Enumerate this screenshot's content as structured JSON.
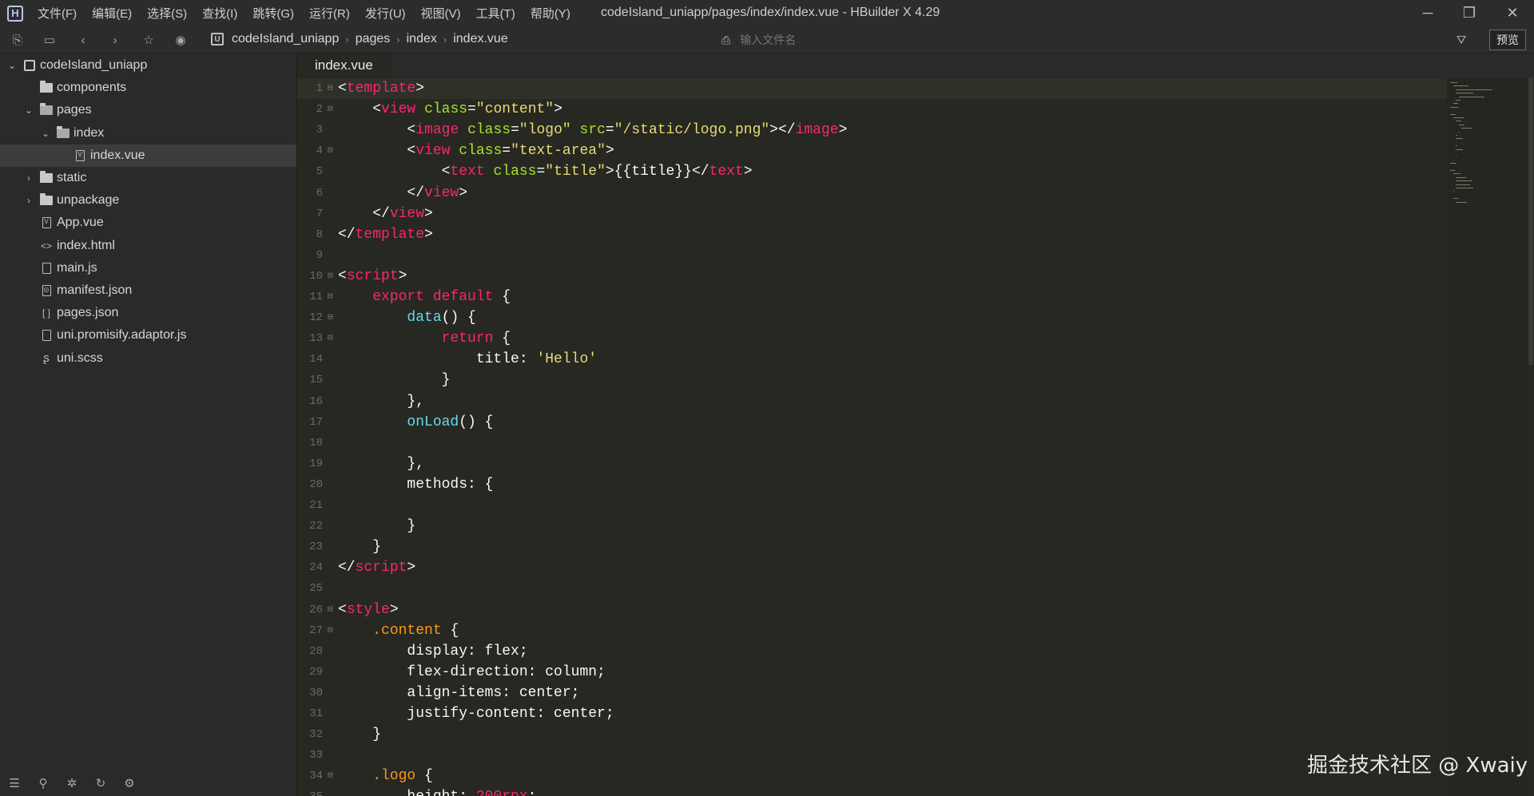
{
  "window": {
    "title": "codeIsland_uniapp/pages/index/index.vue - HBuilder X 4.29",
    "menus": [
      "文件(F)",
      "编辑(E)",
      "选择(S)",
      "查找(I)",
      "跳转(G)",
      "运行(R)",
      "发行(U)",
      "视图(V)",
      "工具(T)",
      "帮助(Y)"
    ]
  },
  "toolbar": {
    "breadcrumbs": [
      "codeIsland_uniapp",
      "pages",
      "index",
      "index.vue"
    ],
    "file_search_placeholder": "输入文件名",
    "preview_label": "预览"
  },
  "sidebar": {
    "items": [
      {
        "label": "codeIsland_uniapp",
        "type": "project",
        "depth": 0,
        "caret": "open"
      },
      {
        "label": "components",
        "type": "folder",
        "depth": 1,
        "caret": "none"
      },
      {
        "label": "pages",
        "type": "folder-open",
        "depth": 1,
        "caret": "open"
      },
      {
        "label": "index",
        "type": "folder-open",
        "depth": 2,
        "caret": "open"
      },
      {
        "label": "index.vue",
        "type": "vue",
        "depth": 3,
        "caret": "none",
        "selected": true
      },
      {
        "label": "static",
        "type": "folder",
        "depth": 1,
        "caret": "closed"
      },
      {
        "label": "unpackage",
        "type": "folder",
        "depth": 1,
        "caret": "closed"
      },
      {
        "label": "App.vue",
        "type": "vue",
        "depth": 1,
        "caret": "none"
      },
      {
        "label": "index.html",
        "type": "html",
        "depth": 1,
        "caret": "none"
      },
      {
        "label": "main.js",
        "type": "js",
        "depth": 1,
        "caret": "none"
      },
      {
        "label": "manifest.json",
        "type": "manifest",
        "depth": 1,
        "caret": "none"
      },
      {
        "label": "pages.json",
        "type": "json",
        "depth": 1,
        "caret": "none"
      },
      {
        "label": "uni.promisify.adaptor.js",
        "type": "js",
        "depth": 1,
        "caret": "none"
      },
      {
        "label": "uni.scss",
        "type": "scss",
        "depth": 1,
        "caret": "none"
      }
    ]
  },
  "editor": {
    "tab_label": "index.vue",
    "lines": [
      {
        "n": "1",
        "fold": true,
        "tokens": [
          [
            "t-tag",
            "<"
          ],
          [
            "t-key",
            "template"
          ],
          [
            "t-tag",
            ">"
          ]
        ]
      },
      {
        "n": "2",
        "fold": true,
        "tokens": [
          [
            "t-prop",
            "    "
          ],
          [
            "t-tag",
            "<"
          ],
          [
            "t-key",
            "view"
          ],
          [
            "t-prop",
            " "
          ],
          [
            "t-attr",
            "class"
          ],
          [
            "t-prop",
            "="
          ],
          [
            "t-str",
            "\"content\""
          ],
          [
            "t-tag",
            ">"
          ]
        ]
      },
      {
        "n": "3",
        "fold": false,
        "tokens": [
          [
            "t-prop",
            "        "
          ],
          [
            "t-tag",
            "<"
          ],
          [
            "t-key",
            "image"
          ],
          [
            "t-prop",
            " "
          ],
          [
            "t-attr",
            "class"
          ],
          [
            "t-prop",
            "="
          ],
          [
            "t-str",
            "\"logo\""
          ],
          [
            "t-prop",
            " "
          ],
          [
            "t-attr",
            "src"
          ],
          [
            "t-prop",
            "="
          ],
          [
            "t-str",
            "\"/static/logo.png\""
          ],
          [
            "t-tag",
            "></"
          ],
          [
            "t-key",
            "image"
          ],
          [
            "t-tag",
            ">"
          ]
        ]
      },
      {
        "n": "4",
        "fold": true,
        "tokens": [
          [
            "t-prop",
            "        "
          ],
          [
            "t-tag",
            "<"
          ],
          [
            "t-key",
            "view"
          ],
          [
            "t-prop",
            " "
          ],
          [
            "t-attr",
            "class"
          ],
          [
            "t-prop",
            "="
          ],
          [
            "t-str",
            "\"text-area\""
          ],
          [
            "t-tag",
            ">"
          ]
        ]
      },
      {
        "n": "5",
        "fold": false,
        "tokens": [
          [
            "t-prop",
            "            "
          ],
          [
            "t-tag",
            "<"
          ],
          [
            "t-key",
            "text"
          ],
          [
            "t-prop",
            " "
          ],
          [
            "t-attr",
            "class"
          ],
          [
            "t-prop",
            "="
          ],
          [
            "t-str",
            "\"title\""
          ],
          [
            "t-tag",
            ">"
          ],
          [
            "t-prop",
            "{{title}}"
          ],
          [
            "t-tag",
            "</"
          ],
          [
            "t-key",
            "text"
          ],
          [
            "t-tag",
            ">"
          ]
        ]
      },
      {
        "n": "6",
        "fold": false,
        "tokens": [
          [
            "t-prop",
            "        "
          ],
          [
            "t-tag",
            "</"
          ],
          [
            "t-key",
            "view"
          ],
          [
            "t-tag",
            ">"
          ]
        ]
      },
      {
        "n": "7",
        "fold": false,
        "tokens": [
          [
            "t-prop",
            "    "
          ],
          [
            "t-tag",
            "</"
          ],
          [
            "t-key",
            "view"
          ],
          [
            "t-tag",
            ">"
          ]
        ]
      },
      {
        "n": "8",
        "fold": false,
        "tokens": [
          [
            "t-tag",
            "</"
          ],
          [
            "t-key",
            "template"
          ],
          [
            "t-tag",
            ">"
          ]
        ]
      },
      {
        "n": "9",
        "fold": false,
        "tokens": []
      },
      {
        "n": "10",
        "fold": true,
        "tokens": [
          [
            "t-tag",
            "<"
          ],
          [
            "t-key",
            "script"
          ],
          [
            "t-tag",
            ">"
          ]
        ]
      },
      {
        "n": "11",
        "fold": true,
        "tokens": [
          [
            "t-prop",
            "    "
          ],
          [
            "t-key",
            "export"
          ],
          [
            "t-prop",
            " "
          ],
          [
            "t-key",
            "default"
          ],
          [
            "t-prop",
            " {"
          ]
        ]
      },
      {
        "n": "12",
        "fold": true,
        "tokens": [
          [
            "t-prop",
            "        "
          ],
          [
            "t-fn",
            "data"
          ],
          [
            "t-prop",
            "() {"
          ]
        ]
      },
      {
        "n": "13",
        "fold": true,
        "tokens": [
          [
            "t-prop",
            "            "
          ],
          [
            "t-key",
            "return"
          ],
          [
            "t-prop",
            " {"
          ]
        ]
      },
      {
        "n": "14",
        "fold": false,
        "tokens": [
          [
            "t-prop",
            "                title: "
          ],
          [
            "t-str",
            "'Hello'"
          ]
        ]
      },
      {
        "n": "15",
        "fold": false,
        "tokens": [
          [
            "t-prop",
            "            }"
          ]
        ]
      },
      {
        "n": "16",
        "fold": false,
        "tokens": [
          [
            "t-prop",
            "        },"
          ]
        ]
      },
      {
        "n": "17",
        "fold": false,
        "tokens": [
          [
            "t-prop",
            "        "
          ],
          [
            "t-fn",
            "onLoad"
          ],
          [
            "t-prop",
            "() {"
          ]
        ]
      },
      {
        "n": "18",
        "fold": false,
        "tokens": []
      },
      {
        "n": "19",
        "fold": false,
        "tokens": [
          [
            "t-prop",
            "        },"
          ]
        ]
      },
      {
        "n": "20",
        "fold": false,
        "tokens": [
          [
            "t-prop",
            "        methods: {"
          ]
        ]
      },
      {
        "n": "21",
        "fold": false,
        "tokens": []
      },
      {
        "n": "22",
        "fold": false,
        "tokens": [
          [
            "t-prop",
            "        }"
          ]
        ]
      },
      {
        "n": "23",
        "fold": false,
        "tokens": [
          [
            "t-prop",
            "    }"
          ]
        ]
      },
      {
        "n": "24",
        "fold": false,
        "tokens": [
          [
            "t-tag",
            "</"
          ],
          [
            "t-key",
            "script"
          ],
          [
            "t-tag",
            ">"
          ]
        ]
      },
      {
        "n": "25",
        "fold": false,
        "tokens": []
      },
      {
        "n": "26",
        "fold": true,
        "tokens": [
          [
            "t-tag",
            "<"
          ],
          [
            "t-key",
            "style"
          ],
          [
            "t-tag",
            ">"
          ]
        ]
      },
      {
        "n": "27",
        "fold": true,
        "tokens": [
          [
            "t-prop",
            "    "
          ],
          [
            "t-sel",
            ".content"
          ],
          [
            "t-prop",
            " {"
          ]
        ]
      },
      {
        "n": "28",
        "fold": false,
        "tokens": [
          [
            "t-prop",
            "        display: flex;"
          ]
        ]
      },
      {
        "n": "29",
        "fold": false,
        "tokens": [
          [
            "t-prop",
            "        flex-direction: column;"
          ]
        ]
      },
      {
        "n": "30",
        "fold": false,
        "tokens": [
          [
            "t-prop",
            "        align-items: center;"
          ]
        ]
      },
      {
        "n": "31",
        "fold": false,
        "tokens": [
          [
            "t-prop",
            "        justify-content: center;"
          ]
        ]
      },
      {
        "n": "32",
        "fold": false,
        "tokens": [
          [
            "t-prop",
            "    }"
          ]
        ]
      },
      {
        "n": "33",
        "fold": false,
        "tokens": []
      },
      {
        "n": "34",
        "fold": true,
        "tokens": [
          [
            "t-prop",
            "    "
          ],
          [
            "t-sel",
            ".logo"
          ],
          [
            "t-prop",
            " {"
          ]
        ]
      },
      {
        "n": "35",
        "fold": false,
        "tokens": [
          [
            "t-prop",
            "        height: "
          ],
          [
            "t-key",
            "200rpx"
          ],
          [
            "t-prop",
            ";"
          ]
        ]
      }
    ]
  },
  "watermark": "掘金技术社区 @ Xwaiy"
}
